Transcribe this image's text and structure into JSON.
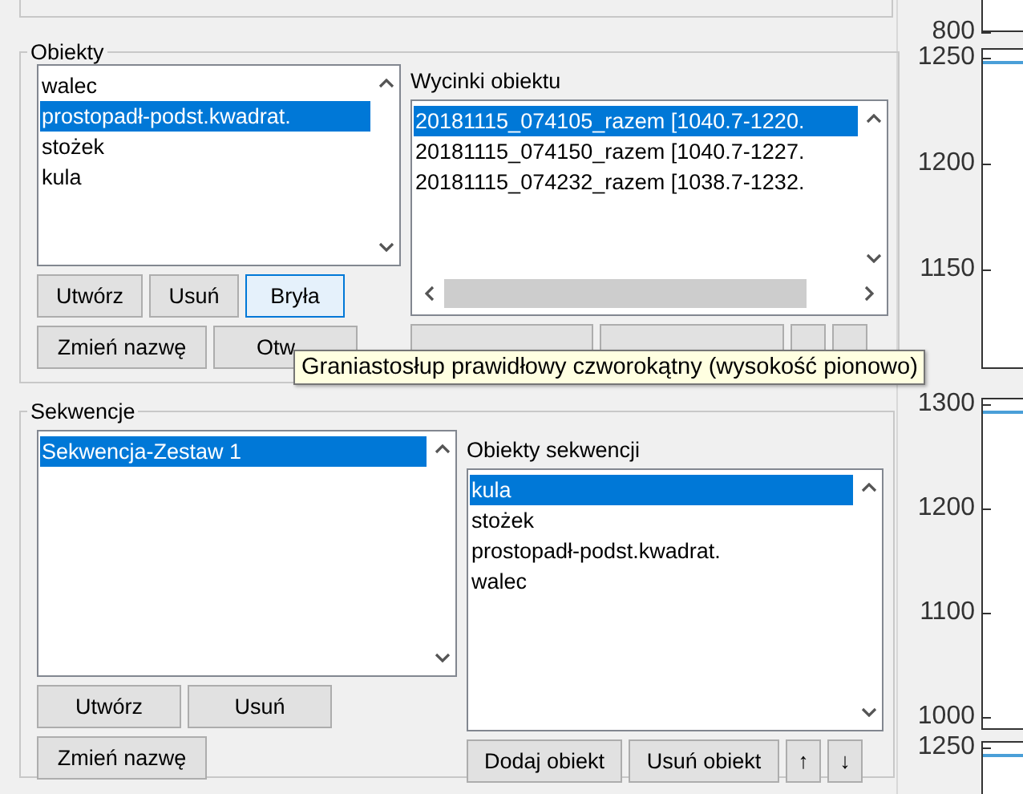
{
  "objects_group": {
    "title": "Obiekty",
    "objects": [
      {
        "label": "walec",
        "selected": false
      },
      {
        "label": "prostopadł-podst.kwadrat.",
        "selected": true
      },
      {
        "label": "stożek",
        "selected": false
      },
      {
        "label": "kula",
        "selected": false
      }
    ],
    "buttons_row1": [
      {
        "label": "Utwórz",
        "focused": false
      },
      {
        "label": "Usuń",
        "focused": false
      },
      {
        "label": "Bryła",
        "focused": true
      }
    ],
    "buttons_row2": [
      "Zmień nazwę",
      "Otw"
    ],
    "slices_label": "Wycinki obiektu",
    "slices": [
      {
        "label": "20181115_074105_razem [1040.7-1220.",
        "selected": true
      },
      {
        "label": "20181115_074150_razem [1040.7-1227.",
        "selected": false
      },
      {
        "label": "20181115_074232_razem [1038.7-1232.",
        "selected": false
      }
    ]
  },
  "tooltip": "Graniastosłup prawidłowy czworokątny (wysokość pionowo)",
  "sequences_group": {
    "title": "Sekwencje",
    "sequences": [
      {
        "label": "Sekwencja-Zestaw 1",
        "selected": true
      }
    ],
    "buttons_row1": [
      "Utwórz",
      "Usuń"
    ],
    "buttons_row2": [
      "Zmień nazwę"
    ],
    "sequence_objects_label": "Obiekty sekwencji",
    "sequence_objects": [
      {
        "label": "kula",
        "selected": true
      },
      {
        "label": "stożek",
        "selected": false
      },
      {
        "label": "prostopadł-podst.kwadrat.",
        "selected": false
      },
      {
        "label": "walec",
        "selected": false
      }
    ],
    "buttons": [
      "Dodaj obiekt",
      "Usuń obiekt",
      "↑",
      "↓"
    ]
  },
  "plots": [
    {
      "ticks": [
        "800"
      ]
    },
    {
      "ticks": [
        "1250",
        "1200",
        "1150"
      ]
    },
    {
      "ticks": [
        "1300",
        "1200",
        "1100",
        "1000"
      ]
    },
    {
      "ticks": [
        "1250"
      ]
    }
  ]
}
